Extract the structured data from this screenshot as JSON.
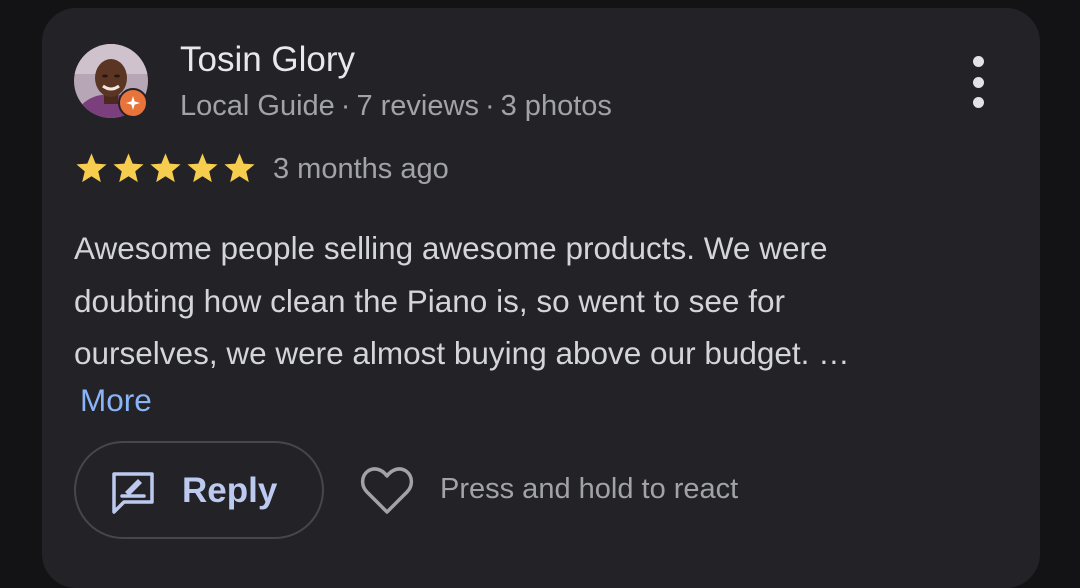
{
  "review": {
    "author": {
      "name": "Tosin Glory",
      "level": "Local Guide",
      "reviews": "7 reviews",
      "photos": "3 photos",
      "separator": "·"
    },
    "rating": 5,
    "time": "3 months ago",
    "text": "Awesome people selling awesome products. We were\ndoubting how clean the Piano is, so went to see for\nourselves, we were almost buying above our budget. …",
    "more_label": "More"
  },
  "actions": {
    "reply_label": "Reply",
    "react_hint": "Press and hold to react"
  },
  "icons": {
    "menu": "more-vert-icon",
    "badge": "local-guide-star-icon",
    "reply": "reply-icon",
    "heart": "heart-outline-icon",
    "star": "star-icon"
  },
  "colors": {
    "star": "#f6cd4e",
    "badge": "#e8743b",
    "link": "#8ab4f8",
    "reply_text": "#bccaef"
  }
}
